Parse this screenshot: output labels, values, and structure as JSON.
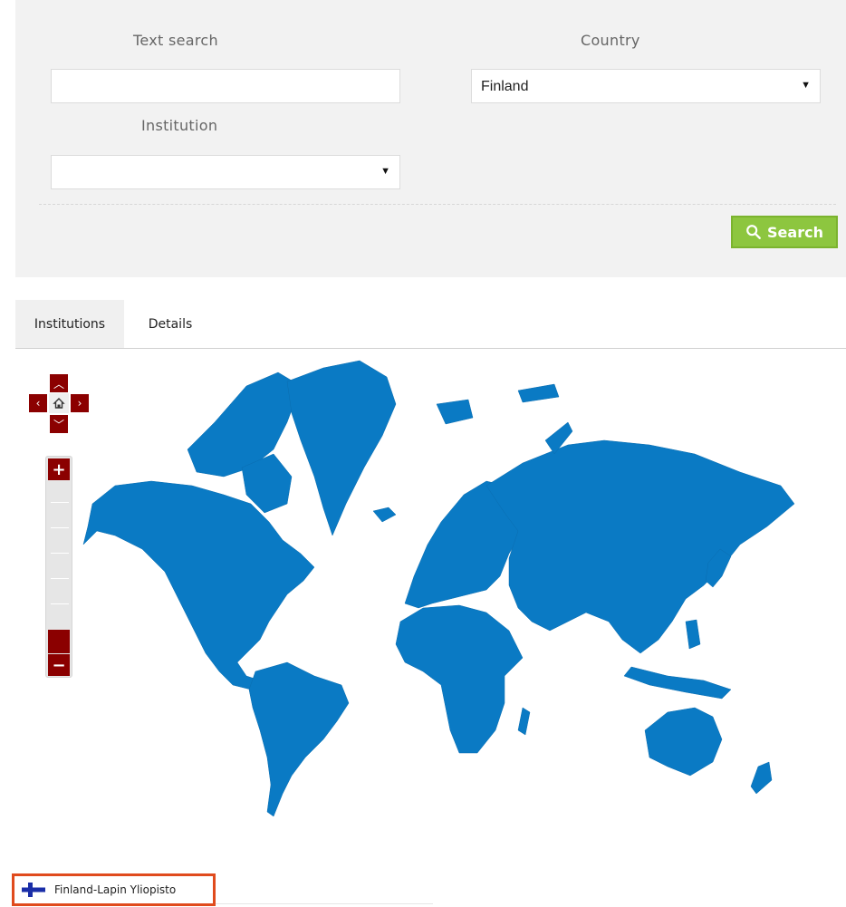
{
  "filters": {
    "text_search_label": "Text search",
    "text_search_value": "",
    "country_label": "Country",
    "country_selected": "Finland",
    "institution_label": "Institution",
    "institution_selected": "",
    "search_button_label": "Search"
  },
  "tabs": [
    {
      "label": "Institutions",
      "active": true
    },
    {
      "label": "Details",
      "active": false
    }
  ],
  "map": {
    "land_color": "#0a7ac4",
    "control_color": "#8b0000",
    "nav_icons": [
      "chevron-up-icon",
      "chevron-left-icon",
      "home-icon",
      "chevron-right-icon",
      "chevron-down-icon"
    ],
    "zoom_in_symbol": "+",
    "zoom_out_symbol": "−"
  },
  "results": [
    {
      "label": "Finland-Lapin Yliopisto",
      "flag": "finland-flag-icon"
    }
  ],
  "colors": {
    "panel_bg": "#f2f2f2",
    "search_button": "#8dc63f",
    "highlight_border": "#e04b1d"
  }
}
